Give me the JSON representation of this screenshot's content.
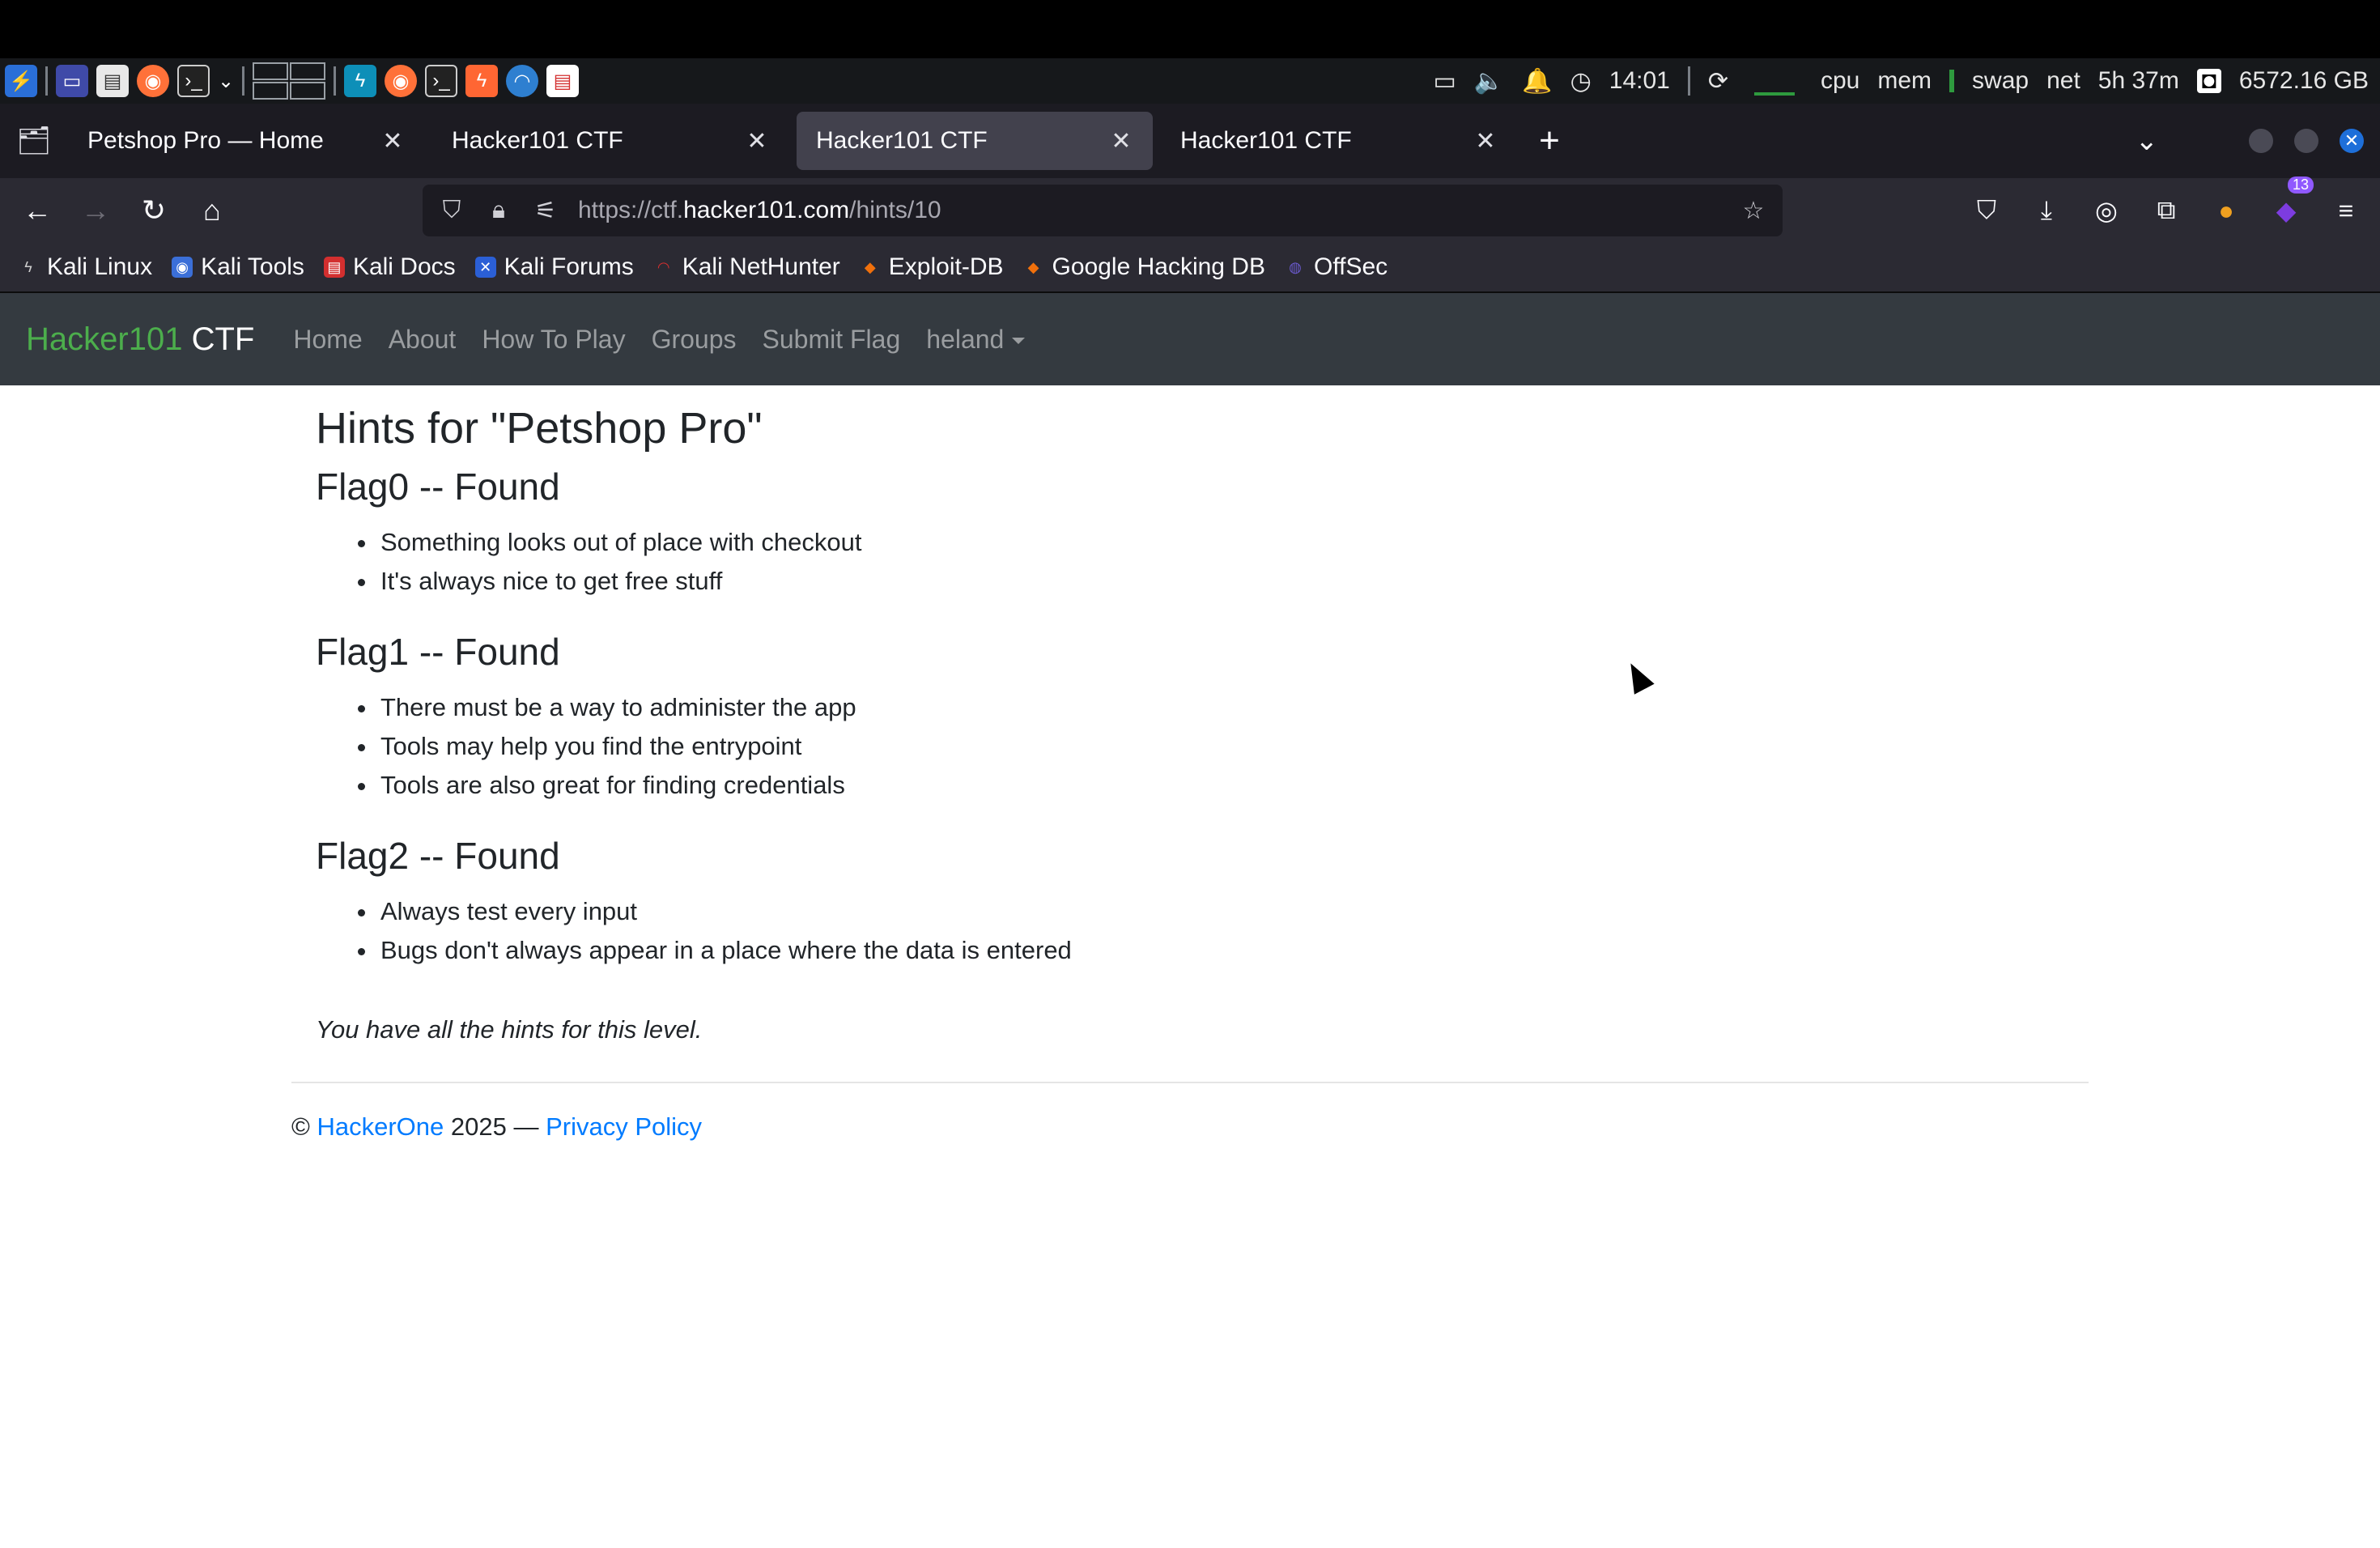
{
  "panel": {
    "time": "14:01",
    "cpu": "cpu",
    "mem": "mem",
    "swap": "swap",
    "net": "net",
    "uptime": "5h 37m",
    "disk": "6572.16 GB",
    "icons": [
      "kali-menu-icon",
      "desktop-icon",
      "files-icon",
      "firefox-icon",
      "terminal-icon",
      "workspaces-icon",
      "app-icon",
      "firefox-icon",
      "terminal-icon",
      "burp-icon",
      "browser-icon",
      "pdf-icon"
    ]
  },
  "tabs": [
    {
      "title": "Petshop Pro — Home",
      "active": false
    },
    {
      "title": "Hacker101 CTF",
      "active": false
    },
    {
      "title": "Hacker101 CTF",
      "active": true
    },
    {
      "title": "Hacker101 CTF",
      "active": false
    }
  ],
  "urlbar": {
    "prefix": "https://ctf.",
    "host": "hacker101.com",
    "path": "/hints/10"
  },
  "extensions_badge": "13",
  "bookmarks": [
    {
      "label": "Kali Linux",
      "color": "#111111"
    },
    {
      "label": "Kali Tools",
      "color": "#3b6fd8"
    },
    {
      "label": "Kali Docs",
      "color": "#d32f2f"
    },
    {
      "label": "Kali Forums",
      "color": "#2b5fd6"
    },
    {
      "label": "Kali NetHunter",
      "color": "#d32f2f"
    },
    {
      "label": "Exploit-DB",
      "color": "#f0700c"
    },
    {
      "label": "Google Hacking DB",
      "color": "#f0700c"
    },
    {
      "label": "OffSec",
      "color": "#6a5acd"
    }
  ],
  "site": {
    "brand_green": "Hacker101",
    "brand_white": "CTF",
    "nav": [
      "Home",
      "About",
      "How To Play",
      "Groups",
      "Submit Flag"
    ],
    "user": "heland"
  },
  "page": {
    "title": "Hints for \"Petshop Pro\"",
    "flags": [
      {
        "title": "Flag0 -- Found",
        "hints": [
          "Something looks out of place with checkout",
          "It's always nice to get free stuff"
        ]
      },
      {
        "title": "Flag1 -- Found",
        "hints": [
          "There must be a way to administer the app",
          "Tools may help you find the entrypoint",
          "Tools are also great for finding credentials"
        ]
      },
      {
        "title": "Flag2 -- Found",
        "hints": [
          "Always test every input",
          "Bugs don't always appear in a place where the data is entered"
        ]
      }
    ],
    "note": "You have all the hints for this level."
  },
  "footer": {
    "copyright": "©",
    "company": "HackerOne",
    "year_sep": "2025 —",
    "privacy": "Privacy Policy"
  },
  "colors": {
    "brand_green": "#4cae4c",
    "link_blue": "#007bff",
    "navbar_bg": "#343a40"
  }
}
